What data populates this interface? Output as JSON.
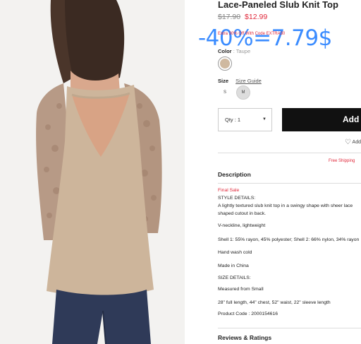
{
  "product": {
    "title": "Lace-Paneled Slub Knit Top",
    "price_old": "$17.90",
    "price_new": "$12.99"
  },
  "promo": {
    "text": "Extra 30% Off With Code EXTRA30",
    "overlay": "-40%=7.79$"
  },
  "color": {
    "label": "Color",
    "value": ": Taupe",
    "swatch_color": "#cfb9a0"
  },
  "size": {
    "label": "Size",
    "guide": "Size Guide",
    "options": [
      "S",
      "M"
    ],
    "selected": "M"
  },
  "qty": {
    "value": "Qty : 1",
    "caret": "▼"
  },
  "add_button": "Add",
  "wishlist": "Add",
  "free_shipping": "Free Shipping",
  "description": {
    "heading": "Description",
    "lines": [
      "Final Sale",
      "STYLE DETAILS:",
      "A lightly textured slub knit top in a swingy shape with sheer lace",
      "shaped cutout in back.",
      "V-neckline, lightweight",
      "Shell 1: 55% rayon, 45% polyester; Shell 2: 66% nylon, 34% rayon",
      "Hand wash cold",
      "Made in China",
      "SIZE DETAILS:",
      "Measured from Small",
      "28\" full length, 44\" chest, 52\" waist, 22\" sleeve length",
      "Product Code : 2000154616"
    ]
  },
  "reviews_heading": "Reviews & Ratings"
}
